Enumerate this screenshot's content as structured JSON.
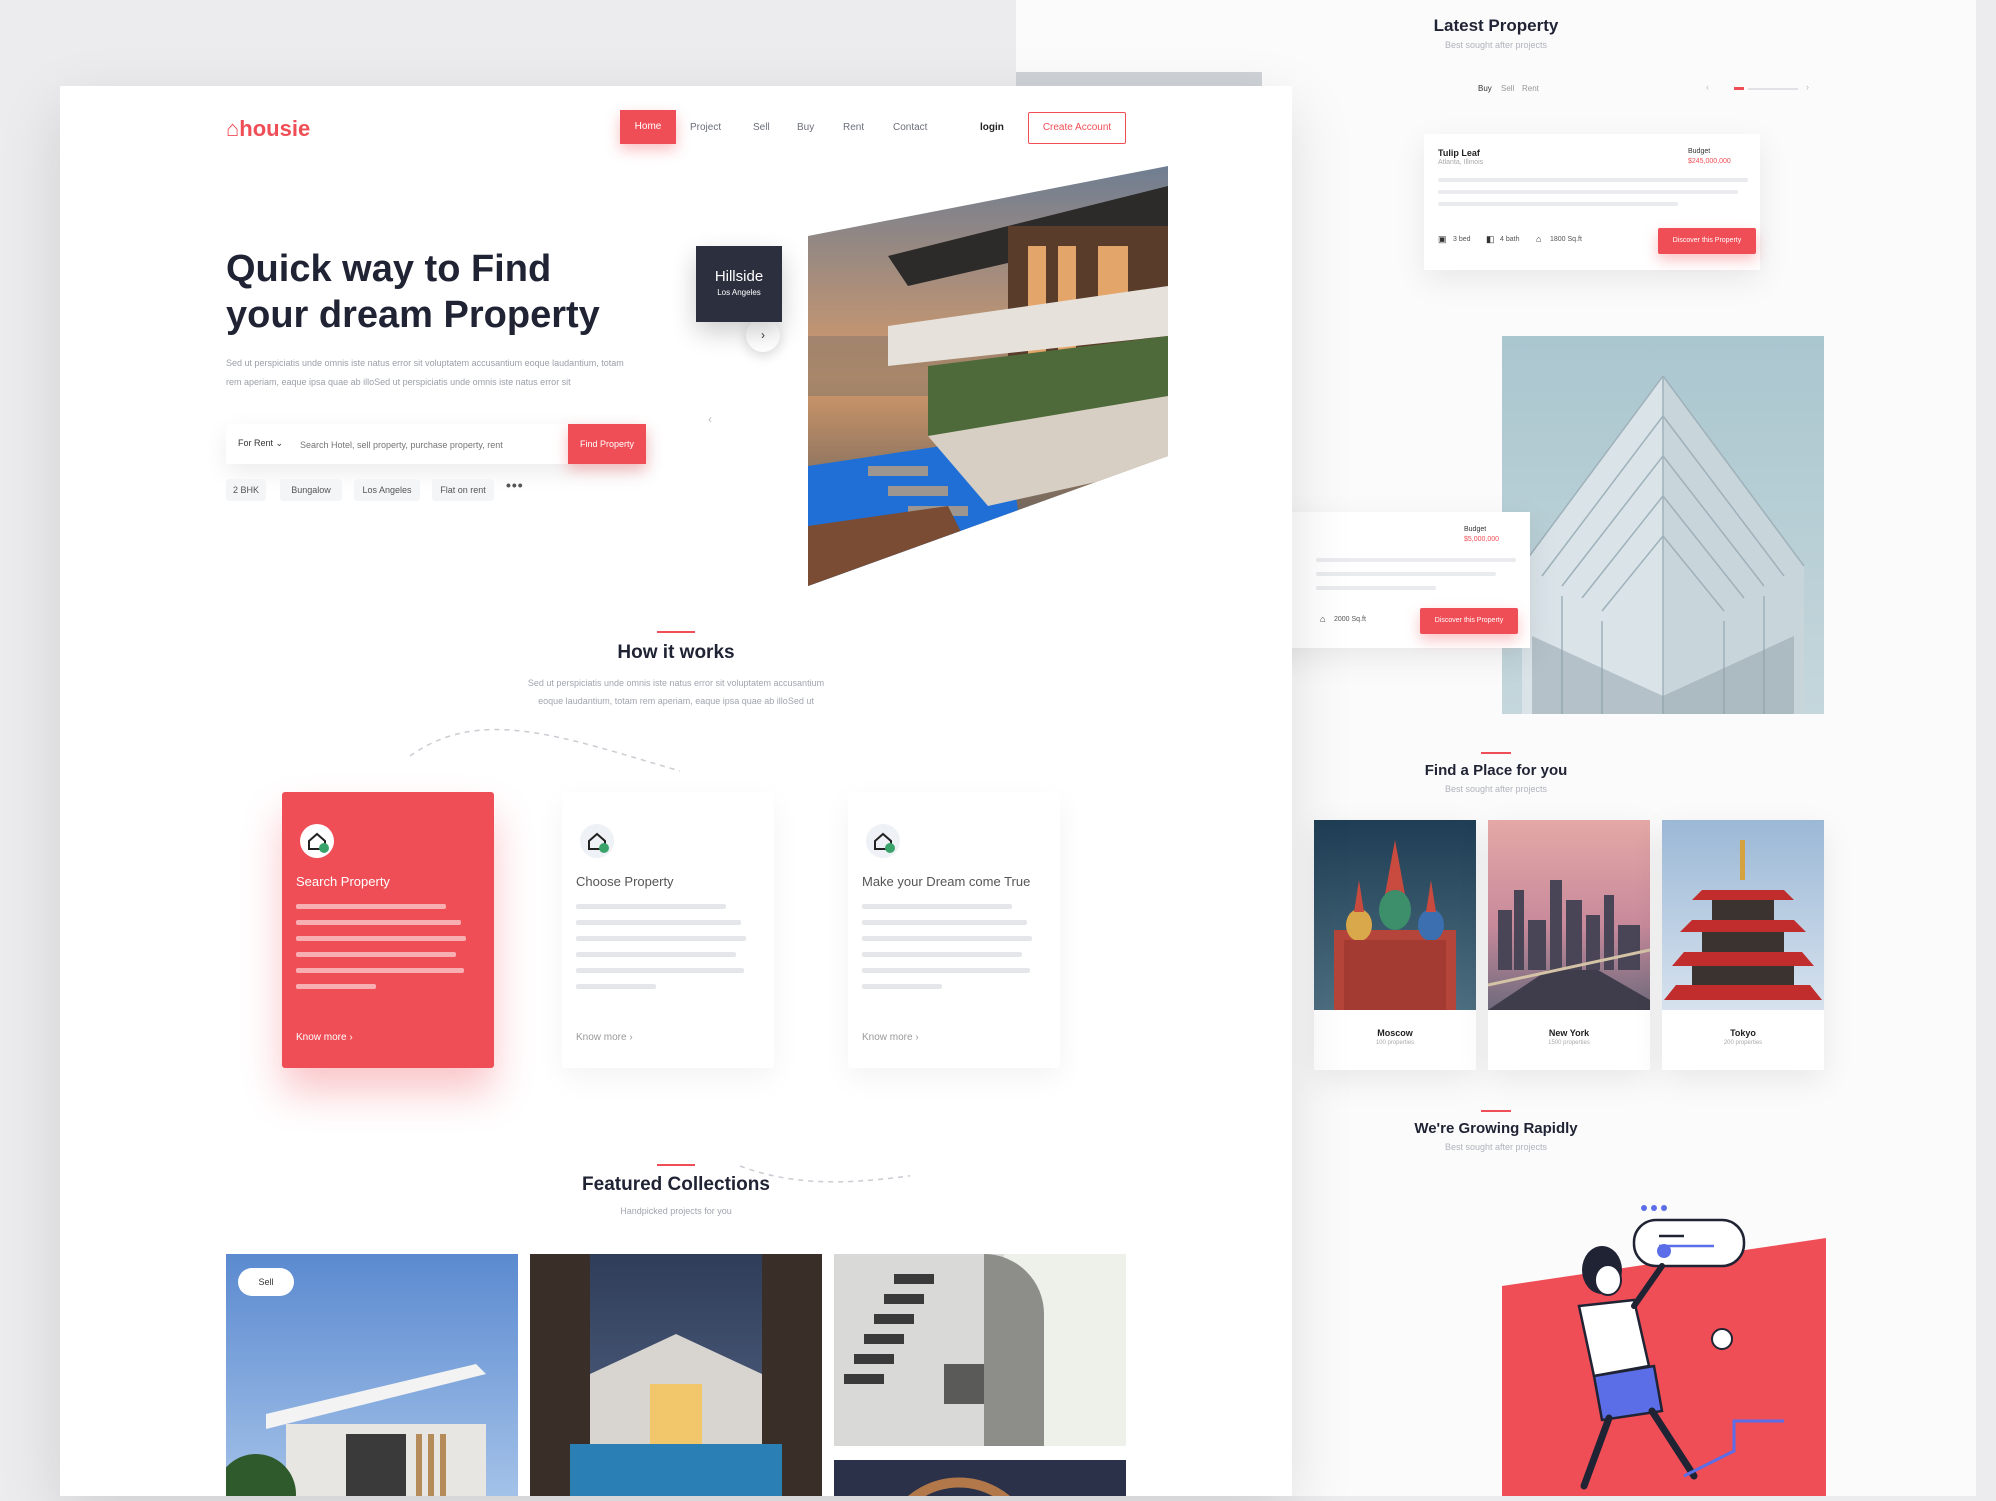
{
  "brand": {
    "name": "housie",
    "accent": "#f04e56"
  },
  "nav": {
    "items": [
      "Home",
      "Project",
      "Sell",
      "Buy",
      "Rent",
      "Contact"
    ],
    "login": "login",
    "create_account": "Create Account"
  },
  "hero": {
    "title_line1": "Quick way to Find",
    "title_line2": "your dream Property",
    "description": "Sed ut perspiciatis unde omnis iste natus error sit voluptatem accusantium eoque laudantium, totam rem aperiam, eaque ipsa quae ab illoSed ut perspiciatis unde omnis iste natus error sit",
    "search": {
      "type_select": "For Rent",
      "placeholder": "Search Hotel, sell property, purchase property, rent",
      "button": "Find Property"
    },
    "tags": [
      "2 BHK",
      "Bungalow",
      "Los Angeles",
      "Flat on rent"
    ],
    "more_icon": "more-dots-icon",
    "photo_badge": {
      "title": "Hillside",
      "subtitle": "Los Angeles"
    }
  },
  "how_it_works": {
    "title": "How it works",
    "description_line1": "Sed ut perspiciatis unde omnis iste natus error sit voluptatem accusantium",
    "description_line2": "eoque laudantium, totam rem aperiam, eaque ipsa quae ab illoSed ut",
    "steps": [
      {
        "title": "Search Property",
        "icon": "home-search-icon",
        "link": "Know more",
        "active": true
      },
      {
        "title": "Choose Property",
        "icon": "home-check-icon",
        "link": "Know more",
        "active": false
      },
      {
        "title": "Make your Dream come True",
        "icon": "home-star-icon",
        "link": "Know more",
        "active": false
      }
    ]
  },
  "featured": {
    "title": "Featured Collections",
    "subtitle": "Handpicked projects for you",
    "first_badge": "Sell"
  },
  "latest": {
    "title": "Latest Property",
    "subtitle": "Best sought after projects",
    "tabs": [
      "Buy",
      "Sell",
      "Rent"
    ],
    "card1": {
      "name": "Tulip Leaf",
      "location": "Atlanta, Illinois",
      "budget_label": "Budget",
      "budget": "$245,000,000",
      "beds": "3 bed",
      "baths": "4 bath",
      "area": "1800 Sq.ft",
      "button": "Discover this Property"
    },
    "card2": {
      "budget_label": "Budget",
      "budget": "$5,000,000",
      "area": "2000 Sq.ft",
      "button": "Discover this Property"
    }
  },
  "places": {
    "title": "Find a Place for you",
    "subtitle": "Best sought after projects",
    "cities": [
      {
        "name": "Moscow",
        "count": "100 properties"
      },
      {
        "name": "New York",
        "count": "1500 properties"
      },
      {
        "name": "Tokyo",
        "count": "200 properties"
      }
    ]
  },
  "growing": {
    "title": "We're Growing Rapidly",
    "subtitle": "Best sought after projects"
  }
}
